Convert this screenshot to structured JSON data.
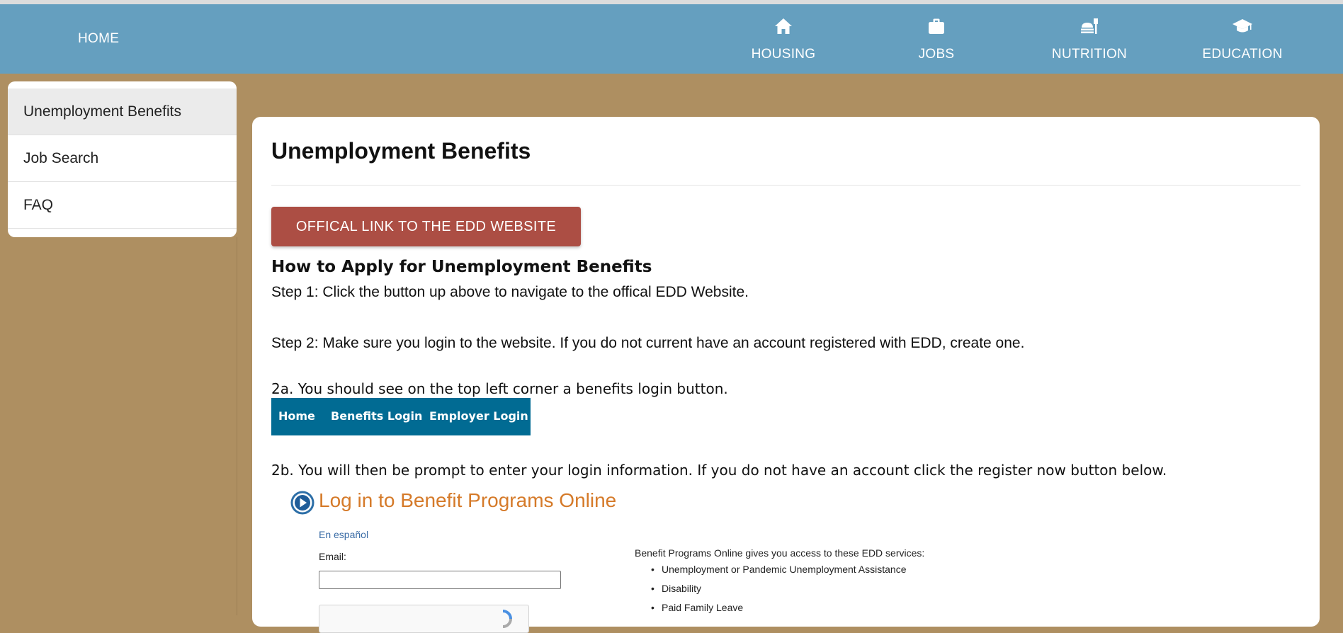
{
  "nav": {
    "home": "HOME",
    "items": [
      {
        "label": "HOUSING",
        "icon": "home-icon"
      },
      {
        "label": "JOBS",
        "icon": "briefcase-icon"
      },
      {
        "label": "NUTRITION",
        "icon": "food-icon"
      },
      {
        "label": "EDUCATION",
        "icon": "graduation-cap-icon"
      }
    ]
  },
  "sidebar": {
    "items": [
      {
        "label": "Unemployment Benefits",
        "active": true
      },
      {
        "label": "Job Search"
      },
      {
        "label": "FAQ"
      }
    ]
  },
  "main": {
    "title": "Unemployment Benefits",
    "edd_button": "OFFICAL LINK TO THE EDD WEBSITE",
    "section_heading": "How to Apply for Unemployment Benefits",
    "step1": "Step 1: Click the button up above to navigate to the offical EDD Website.",
    "step2": "Step 2: Make sure you login to the website. If you do not current have an account registered with EDD, create one.",
    "step2a": "2a. You should see on the top left corner a benefits login button.",
    "edd_nav": [
      "Home",
      "Benefits Login",
      "Employer Login"
    ],
    "step2b": "2b. You will then be prompt to enter your login information. If you do not have an account click the register now button below.",
    "login": {
      "title": "Log in to Benefit Programs Online",
      "espanol": "En español",
      "email_label": "Email:",
      "email_value": "",
      "intro": "Benefit Programs Online gives you access to these EDD services:",
      "services": [
        "Unemployment or Pandemic Unemployment Assistance",
        "Disability",
        "Paid Family Leave"
      ]
    }
  },
  "colors": {
    "navbar": "#659fbf",
    "page_bg": "#ae8f61",
    "button": "#ac4e44",
    "edd_nav": "#016b93",
    "login_title": "#d57a29"
  }
}
